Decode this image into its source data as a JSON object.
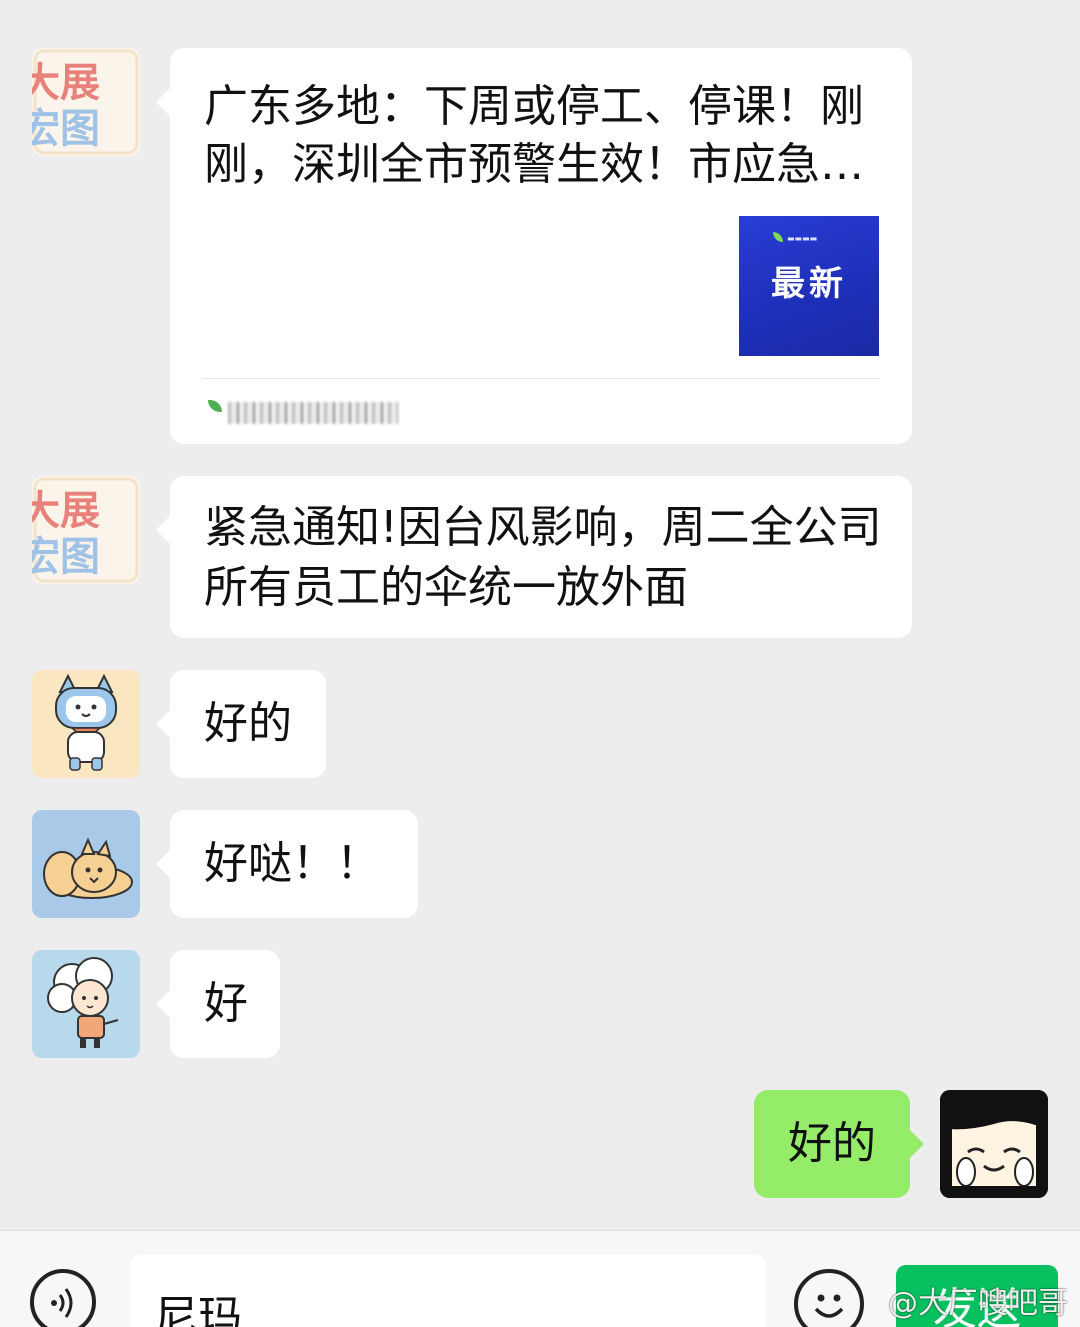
{
  "chat": {
    "messages": [
      {
        "type": "link",
        "sender_avatar_lines": [
          "大展",
          "宏图"
        ],
        "title_lines": [
          "广东多地：下周或停工、停课！刚",
          "刚，深圳全市预警生效！市应急…"
        ],
        "thumb_text": "最新"
      },
      {
        "type": "text",
        "sender_avatar_lines": [
          "大展",
          "宏图"
        ],
        "text_lines": [
          "紧急通知!因台风影响，周二全公司",
          "所有员工的伞统一放外面"
        ]
      },
      {
        "type": "text",
        "text": "好的"
      },
      {
        "type": "text",
        "text": "好哒！！"
      },
      {
        "type": "text",
        "text": "好"
      },
      {
        "type": "text",
        "side": "right",
        "text": "好的"
      }
    ]
  },
  "input_bar": {
    "input_value": "尼玛",
    "send_label": "发送"
  },
  "watermark": "@大厂嗖吧哥",
  "colors": {
    "background": "#ededed",
    "bubble_incoming": "#ffffff",
    "bubble_outgoing": "#95ec69",
    "send_button": "#07c160",
    "thumb_blue": "#1d2fb8"
  }
}
